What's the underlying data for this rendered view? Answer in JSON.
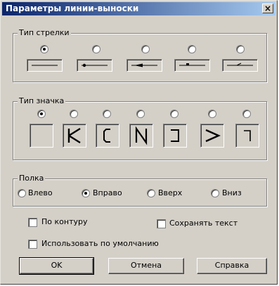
{
  "window": {
    "title": "Параметры линии-выноски",
    "close_label": "×"
  },
  "arrow_type": {
    "legend": "Тип стрелки",
    "options": [
      {
        "icon": "plain-line-icon",
        "selected": true
      },
      {
        "icon": "dot-arrow-line-icon",
        "selected": false
      },
      {
        "icon": "filled-arrow-line-icon",
        "selected": false
      },
      {
        "icon": "tick-arrow-line-icon",
        "selected": false
      },
      {
        "icon": "open-arrow-line-icon",
        "selected": false
      }
    ]
  },
  "mark_type": {
    "legend": "Тип значка",
    "options": [
      {
        "glyph": "",
        "icon": "empty-mark-icon",
        "selected": true
      },
      {
        "glyph": "K",
        "icon": "k-mark-icon",
        "selected": false
      },
      {
        "glyph": "C",
        "icon": "c-mark-icon",
        "selected": false
      },
      {
        "glyph": "N",
        "icon": "n-mark-icon",
        "selected": false
      },
      {
        "glyph": "]",
        "icon": "bracket-mark-icon",
        "selected": false
      },
      {
        "glyph": ">",
        "icon": "greater-mark-icon",
        "selected": false
      },
      {
        "glyph": "¬",
        "icon": "corner-mark-icon",
        "selected": false
      }
    ]
  },
  "shelf": {
    "legend": "Полка",
    "options": [
      {
        "label": "Влево",
        "selected": false
      },
      {
        "label": "Вправо",
        "selected": true
      },
      {
        "label": "Вверх",
        "selected": false
      },
      {
        "label": "Вниз",
        "selected": false
      }
    ]
  },
  "checkboxes": {
    "by_contour": {
      "label": "По контуру",
      "checked": false
    },
    "keep_text": {
      "label": "Сохранять текст",
      "checked": false
    },
    "use_default": {
      "label": "Использовать по умолчанию",
      "checked": false
    }
  },
  "buttons": {
    "ok": "OK",
    "cancel": "Отмена",
    "help": "Справка"
  }
}
